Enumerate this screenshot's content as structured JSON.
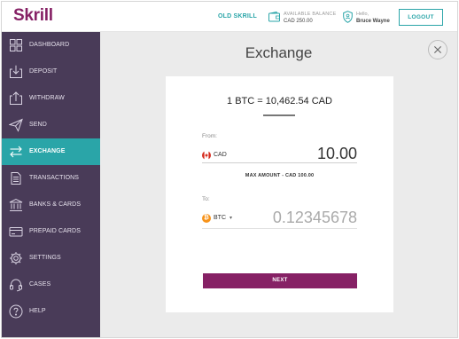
{
  "header": {
    "logo": "Skrill",
    "old_skrill": "OLD SKRILL",
    "balance_label": "AVAILABLE BALANCE",
    "balance_value": "CAD 250.00",
    "user_label": "Hello,",
    "user_name": "Bruce Wayne",
    "logout": "LOGOUT"
  },
  "sidebar": {
    "items": [
      {
        "label": "DASHBOARD",
        "icon": "dashboard-icon",
        "active": false
      },
      {
        "label": "DEPOSIT",
        "icon": "deposit-icon",
        "active": false
      },
      {
        "label": "WITHDRAW",
        "icon": "withdraw-icon",
        "active": false
      },
      {
        "label": "SEND",
        "icon": "send-icon",
        "active": false
      },
      {
        "label": "EXCHANGE",
        "icon": "exchange-icon",
        "active": true
      },
      {
        "label": "TRANSACTIONS",
        "icon": "transactions-icon",
        "active": false
      },
      {
        "label": "BANKS & CARDS",
        "icon": "bank-icon",
        "active": false
      },
      {
        "label": "PREPAID CARDS",
        "icon": "card-icon",
        "active": false
      },
      {
        "label": "SETTINGS",
        "icon": "gear-icon",
        "active": false
      },
      {
        "label": "CASES",
        "icon": "headset-icon",
        "active": false
      },
      {
        "label": "HELP",
        "icon": "help-icon",
        "active": false
      }
    ]
  },
  "main": {
    "title": "Exchange",
    "rate": "1 BTC = 10,462.54 CAD",
    "from_label": "From:",
    "from_currency": "CAD",
    "from_amount": "10.00",
    "max_amount": "MAX AMOUNT -  CAD 100.00",
    "to_label": "To:",
    "to_currency": "BTC",
    "to_caret": "▾",
    "to_amount": "0.12345678",
    "next": "NEXT"
  },
  "colors": {
    "brand": "#862165",
    "teal": "#2aa5a8",
    "sidebar": "#493b58",
    "bitcoin": "#f7931a"
  }
}
